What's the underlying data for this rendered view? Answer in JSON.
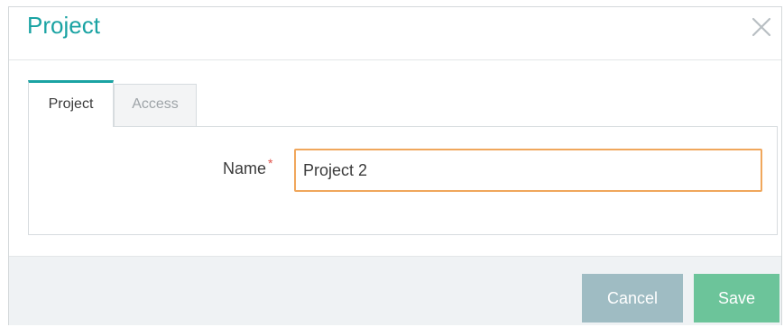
{
  "dialog": {
    "title": "Project",
    "close_icon": "close-icon"
  },
  "tabs": [
    {
      "label": "Project",
      "active": true
    },
    {
      "label": "Access",
      "active": false
    }
  ],
  "form": {
    "name_label": "Name",
    "required_marker": "*",
    "name_value": "Project 2"
  },
  "footer": {
    "cancel_label": "Cancel",
    "save_label": "Save"
  },
  "colors": {
    "accent": "#1aa3a3",
    "input_focus_border": "#f0a75c",
    "cancel_button": "#9fbcc3",
    "save_button": "#6cc49a",
    "required": "#e0524a"
  }
}
